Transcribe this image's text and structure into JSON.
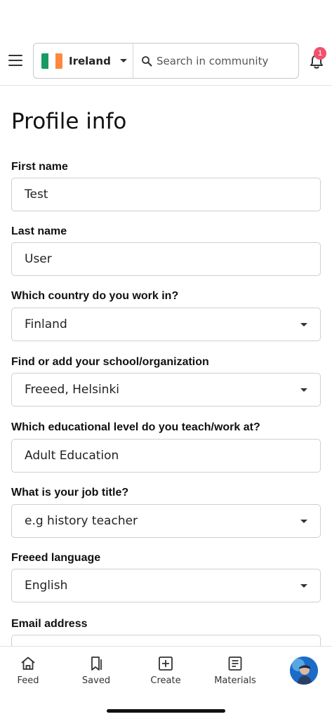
{
  "header": {
    "country": "Ireland",
    "flag_colors": [
      "#169b62",
      "#ffffff",
      "#ff883e"
    ],
    "search_placeholder": "Search in community",
    "notification_count": "1",
    "badge_color": "#f0506e"
  },
  "page": {
    "title": "Profile info"
  },
  "form": {
    "first_name": {
      "label": "First name",
      "value": "Test"
    },
    "last_name": {
      "label": "Last name",
      "value": "User"
    },
    "country": {
      "label": "Which country do you work in?",
      "value": "Finland"
    },
    "school": {
      "label": "Find or add your school/organization",
      "value": "Freeed, Helsinki"
    },
    "level": {
      "label": "Which educational level do you teach/work at?",
      "value": "Adult Education"
    },
    "job_title": {
      "label": "What is your job title?",
      "placeholder": "e.g history teacher"
    },
    "language": {
      "label": "Freeed language",
      "value": "English"
    },
    "email": {
      "label": "Email address",
      "value": ""
    }
  },
  "nav": {
    "feed": "Feed",
    "saved": "Saved",
    "create": "Create",
    "materials": "Materials"
  },
  "icons": [
    "menu-icon",
    "flag-icon",
    "search-icon",
    "bell-icon",
    "home-icon",
    "bookmark-icon",
    "plus-square-icon",
    "document-icon"
  ]
}
